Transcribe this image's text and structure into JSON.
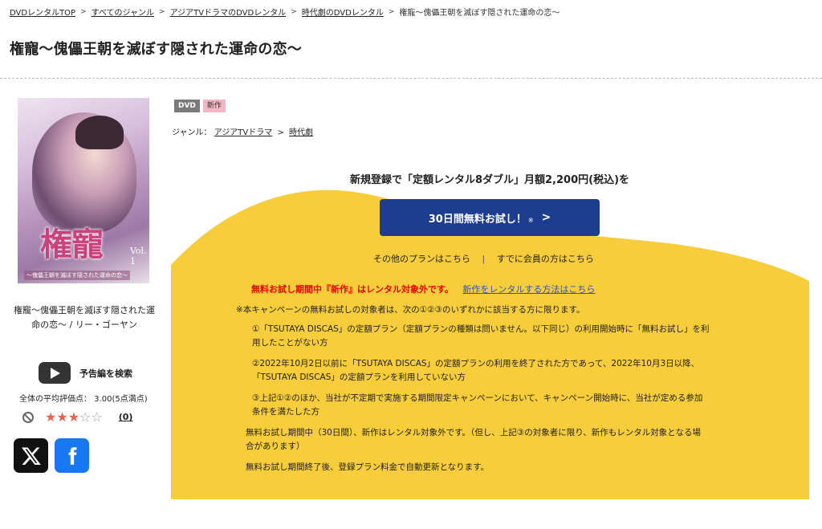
{
  "breadcrumb": {
    "items": [
      "DVDレンタルTOP",
      "すべてのジャンル",
      "アジアTVドラマのDVDレンタル",
      "時代劇のDVDレンタル"
    ],
    "separator": ">",
    "current": "権寵～傀儡王朝を滅ぼす隠された運命の恋～"
  },
  "title": "権寵～傀儡王朝を滅ぼす隠された運命の恋～",
  "cover": {
    "title": "権寵",
    "vol": "Vol. 1",
    "subtitle": "～傀儡王朝を滅ぼす隠された運命の恋～"
  },
  "product": {
    "caption": "権寵～傀儡王朝を滅ぼす隠された運命の恋～ / リー・ゴーヤン",
    "trailer_label": "予告編を検索",
    "rating_text": "全体の平均評価点： 3.00(5点満点)",
    "rating_value": 3,
    "rating_max": 5,
    "review_count": "(0)"
  },
  "tags": {
    "dvd": "DVD",
    "new": "新作"
  },
  "genre": {
    "label": "ジャンル：",
    "links": [
      "アジアTVドラマ",
      "時代劇"
    ],
    "separator": ">"
  },
  "promo": {
    "headline": "新規登録で「定額レンタル8ダブル」月額2,200円(税込)を",
    "cta_label": "30日間無料お試し！",
    "cta_note": "※",
    "cta_arrow": ">",
    "other_plans": "その他のプランはこちら",
    "plan_separator": "|",
    "member_link": "すでに会員の方はこちら",
    "red_notice": "無料お試し期間中『新作』はレンタル対象外です。",
    "new_rental_link": "新作をレンタルする方法はこちら",
    "colors": {
      "yellow": "#f8cd3b",
      "cta_blue": "#1d3e8e"
    }
  },
  "terms": {
    "intro": "※本キャンペーンの無料お試しの対象者は、次の①②③のいずれかに該当する方に限ります。",
    "item1_line1": "①「TSUTAYA DISCAS」の定額プラン（定額プランの種類は問いません。以下同じ）の利用開始時に「無料お試し」を利",
    "item1_line2": "用したことがない方",
    "item2_line1": "②2022年10月2日以前に「TSUTAYA DISCAS」の定額プランの利用を終了された方であって、2022年10月3日以降、",
    "item2_line2": "「TSUTAYA DISCAS」の定額プランを利用していない方",
    "item3_line1": "③上記①②のほか、当社が不定期で実施する期間限定キャンペーンにおいて、キャンペーン開始時に、当社が定める参加",
    "item3_line2": "条件を満たした方",
    "note1_line1": "無料お試し期間中（30日間）、新作はレンタル対象外です。（但し、上記③の対象者に限り、新作もレンタル対象となる場",
    "note1_line2": "合があります）",
    "note2": "無料お試し期間終了後、登録プラン料金で自動更新となります。"
  }
}
